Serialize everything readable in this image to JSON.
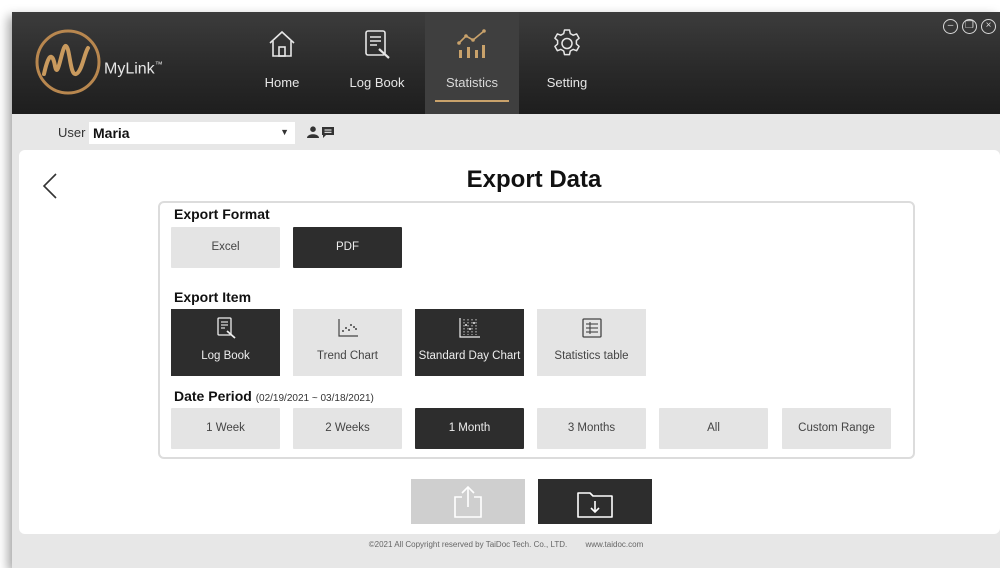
{
  "app": {
    "name": "MyLink",
    "trademark": "™"
  },
  "nav": [
    {
      "label": "Home",
      "icon": "home-icon"
    },
    {
      "label": "Log Book",
      "icon": "logbook-icon"
    },
    {
      "label": "Statistics",
      "icon": "statistics-icon",
      "active": true
    },
    {
      "label": "Setting",
      "icon": "gear-icon"
    }
  ],
  "window_controls": [
    "minimize-icon",
    "restore-icon",
    "close-icon"
  ],
  "user": {
    "label": "User",
    "value": "Maria"
  },
  "page": {
    "title": "Export Data"
  },
  "export_format": {
    "heading": "Export Format",
    "options": [
      {
        "label": "Excel",
        "selected": false
      },
      {
        "label": "PDF",
        "selected": true
      }
    ]
  },
  "export_item": {
    "heading": "Export Item",
    "options": [
      {
        "label": "Log Book",
        "icon": "logbook-icon",
        "selected": true
      },
      {
        "label": "Trend Chart",
        "icon": "scatter-chart-icon",
        "selected": false
      },
      {
        "label": "Standard Day Chart",
        "icon": "standard-day-chart-icon",
        "selected": true
      },
      {
        "label": "Statistics table",
        "icon": "table-icon",
        "selected": false
      }
    ]
  },
  "date_period": {
    "heading": "Date Period",
    "range": "(02/19/2021 ~ 03/18/2021)",
    "options": [
      {
        "label": "1 Week",
        "selected": false
      },
      {
        "label": "2 Weeks",
        "selected": false
      },
      {
        "label": "1 Month",
        "selected": true
      },
      {
        "label": "3 Months",
        "selected": false
      },
      {
        "label": "All",
        "selected": false
      },
      {
        "label": "Custom Range",
        "selected": false
      }
    ]
  },
  "actions": {
    "share_icon": "share-icon",
    "save_icon": "save-to-folder-icon"
  },
  "footer": {
    "copyright": "©2021 All Copyright reserved by TaiDoc Tech. Co., LTD.",
    "website": "www.taidoc.com"
  },
  "colors": {
    "accent": "#c9a26b",
    "selected": "#2d2d2d",
    "unselected": "#e4e4e4",
    "header": "#2a2a2a"
  }
}
